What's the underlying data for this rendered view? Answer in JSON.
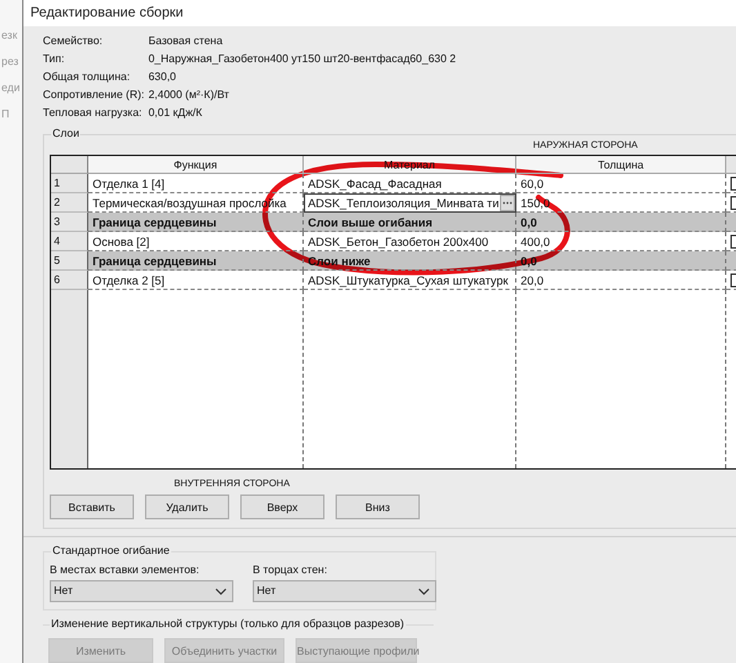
{
  "background_window": {
    "fragments": [
      "езк",
      "рез",
      "еди",
      "П"
    ]
  },
  "window": {
    "title": "Редактирование сборки"
  },
  "properties": [
    {
      "label": "Семейство:",
      "value": "Базовая стена"
    },
    {
      "label": "Тип:",
      "value": "0_Наружная_Газобетон400 ут150 шт20-вентфасад60_630 2"
    },
    {
      "label": "Общая толщина:",
      "value": "630,0"
    },
    {
      "label": "Сопротивление (R):",
      "value": "2,4000 (м²·К)/Вт"
    },
    {
      "label": "Тепловая нагрузка:",
      "value": "0,01 кДж/К"
    }
  ],
  "layers": {
    "title": "Слои",
    "exterior_label": "НАРУЖНАЯ СТОРОНА",
    "interior_label": "ВНУТРЕННЯЯ СТОРОНА",
    "columns": [
      "Функция",
      "Материал",
      "Толщина"
    ],
    "rows": [
      {
        "number": "1",
        "function": "Отделка 1 [4]",
        "material": "ADSK_Фасад_Фасадная",
        "thickness": "60,0",
        "kind": "layer",
        "editing": false,
        "checked": false
      },
      {
        "number": "2",
        "function": "Термическая/воздушная прослойка",
        "material": "ADSK_Теплоизоляция_Минвата ти",
        "thickness": "150,0",
        "kind": "layer",
        "editing": true,
        "checked": false
      },
      {
        "number": "3",
        "function": "Граница сердцевины",
        "material": "Слои выше огибания",
        "thickness": "0,0",
        "kind": "boundary"
      },
      {
        "number": "4",
        "function": "Основа [2]",
        "material": "ADSK_Бетон_Газобетон 200x400",
        "thickness": "400,0",
        "kind": "layer",
        "editing": false,
        "checked": false
      },
      {
        "number": "5",
        "function": "Граница сердцевины",
        "material": "Слои ниже",
        "thickness": "0,0",
        "kind": "boundary"
      },
      {
        "number": "6",
        "function": "Отделка 2 [5]",
        "material": "ADSK_Штукатурка_Сухая штукатурк",
        "thickness": "20,0",
        "kind": "layer",
        "editing": false,
        "checked": false
      }
    ]
  },
  "layer_buttons": [
    "Вставить",
    "Удалить",
    "Вверх",
    "Вниз"
  ],
  "wrapping": {
    "title": "Стандартное огибание",
    "fields": [
      {
        "label": "В местах вставки элементов:",
        "value": "Нет"
      },
      {
        "label": "В торцах стен:",
        "value": "Нет"
      }
    ]
  },
  "vertical_structure": {
    "title": "Изменение вертикальной структуры (только для образцов разрезов)",
    "buttons": [
      {
        "label": "Изменить",
        "disabled": true
      },
      {
        "label": "Объединить участки",
        "disabled": true
      },
      {
        "label": "Выступающие профили",
        "disabled": true
      }
    ]
  }
}
